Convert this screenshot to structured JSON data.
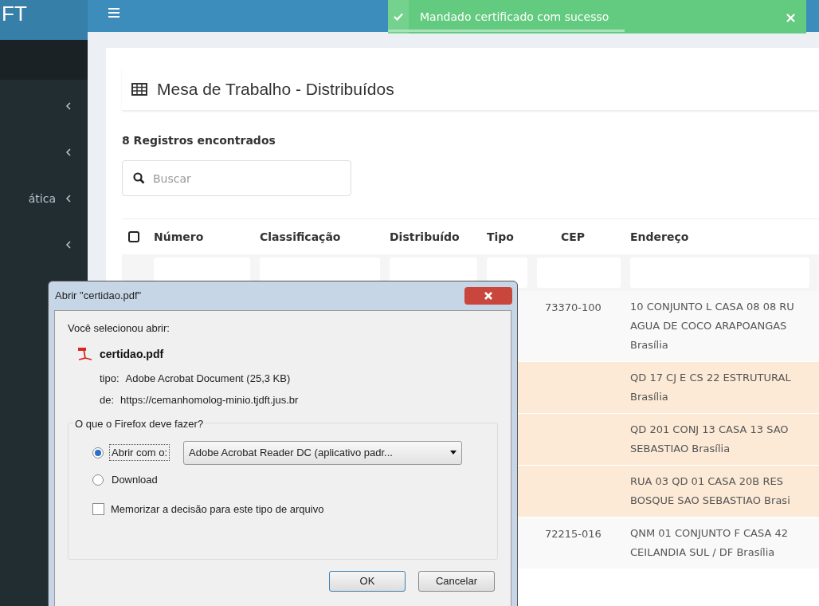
{
  "logo": "FT",
  "sidebar": {
    "items": [
      {
        "expanded": false
      },
      {
        "expanded": false
      },
      {
        "label": "ática",
        "expanded": false
      },
      {
        "expanded": false
      }
    ]
  },
  "toast": {
    "message": "Mandado certificado com sucesso",
    "close": "×"
  },
  "page": {
    "title": "Mesa de Trabalho - Distribuídos",
    "count": "8 Registros encontrados",
    "search": {
      "placeholder": "Buscar"
    }
  },
  "table": {
    "select_all": {
      "checked": false
    },
    "columns": [
      "Número",
      "Classificação",
      "Distribuído",
      "Tipo",
      "CEP",
      "Endereço"
    ],
    "rows": [
      {
        "cep": "73370-100",
        "address": [
          "10 CONJUNTO L CASA 08 08 RU",
          "AGUA DE COCO ARAPOANGAS",
          "Brasília"
        ],
        "highlighted": false
      },
      {
        "address": [
          "QD 17 CJ E CS 22 ESTRUTURAL",
          "Brasília"
        ],
        "highlighted": true
      },
      {
        "address": [
          "QD 201 CONJ 13 CASA 13 SAO",
          "SEBASTIAO Brasília"
        ],
        "highlighted": true
      },
      {
        "address": [
          "RUA 03 QD 01 CASA 20B RES",
          "BOSQUE SAO SEBASTIAO Brasi"
        ],
        "highlighted": true
      },
      {
        "cep": "72215-016",
        "address": [
          "QNM 01 CONJUNTO F CASA 42",
          "CEILANDIA SUL / DF Brasília"
        ],
        "highlighted": false
      }
    ]
  },
  "dialog": {
    "title": "Abrir \"certidao.pdf\"",
    "intro": "Você selecionou abrir:",
    "file": "certidao.pdf",
    "type_label": "tipo:",
    "type_value": "Adobe Acrobat Document (25,3 KB)",
    "from_label": "de:",
    "from_value": "https://cemanhomolog-minio.tjdft.jus.br",
    "group_title": "O que o Firefox deve fazer?",
    "options": [
      {
        "label": "Abrir com o:",
        "selected": true,
        "kind": "app"
      },
      {
        "label": "Download",
        "selected": false,
        "kind": "plain"
      }
    ],
    "app_value": "Adobe Acrobat Reader DC  (aplicativo padr...",
    "remember": {
      "label": "Memorizar a decisão para este tipo de arquivo",
      "checked": false
    },
    "buttons": [
      {
        "label": "OK",
        "default": true
      },
      {
        "label": "Cancelar",
        "default": false
      }
    ]
  }
}
